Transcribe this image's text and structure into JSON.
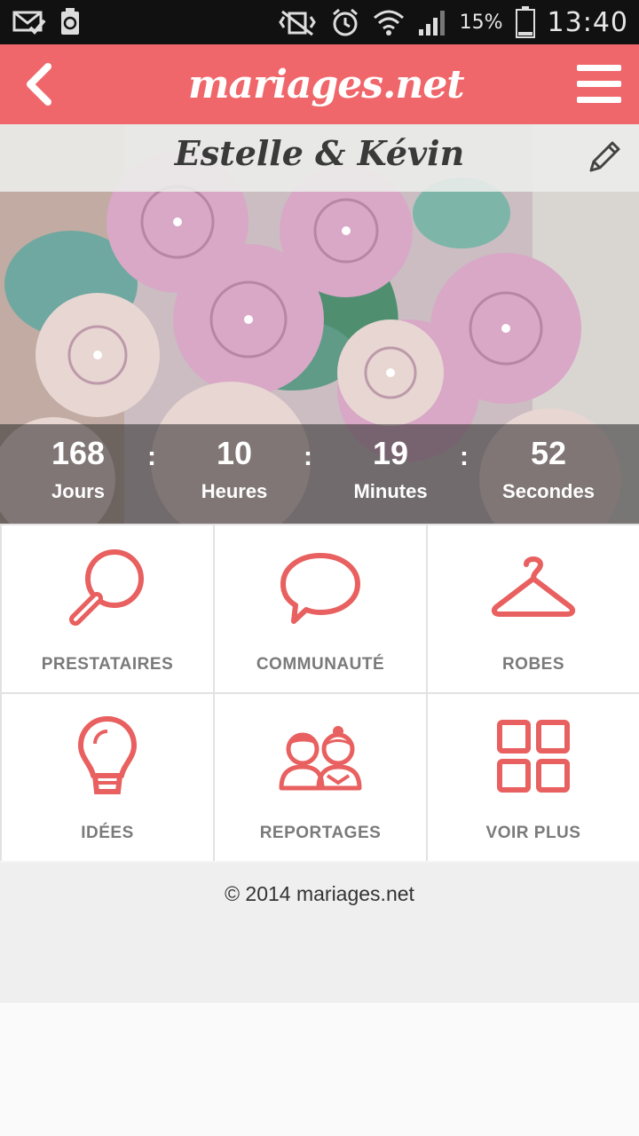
{
  "status_bar": {
    "battery_percent": "15%",
    "time": "13:40"
  },
  "header": {
    "logo_text": "mariages.net",
    "brand_color": "#f0676b"
  },
  "hero": {
    "couple_names": "Estelle & Kévin",
    "countdown": [
      {
        "value": "168",
        "label": "Jours"
      },
      {
        "value": "10",
        "label": "Heures"
      },
      {
        "value": "19",
        "label": "Minutes"
      },
      {
        "value": "52",
        "label": "Secondes"
      }
    ],
    "separator": ":"
  },
  "menu_tiles": [
    {
      "label": "PRESTATAIRES",
      "icon": "magnifier-icon"
    },
    {
      "label": "COMMUNAUTÉ",
      "icon": "speech-bubble-icon"
    },
    {
      "label": "ROBES",
      "icon": "hanger-icon"
    },
    {
      "label": "IDÉES",
      "icon": "lightbulb-icon"
    },
    {
      "label": "REPORTAGES",
      "icon": "couple-icon"
    },
    {
      "label": "VOIR PLUS",
      "icon": "grid-icon"
    }
  ],
  "footer": {
    "copyright": "© 2014 mariages.net"
  }
}
